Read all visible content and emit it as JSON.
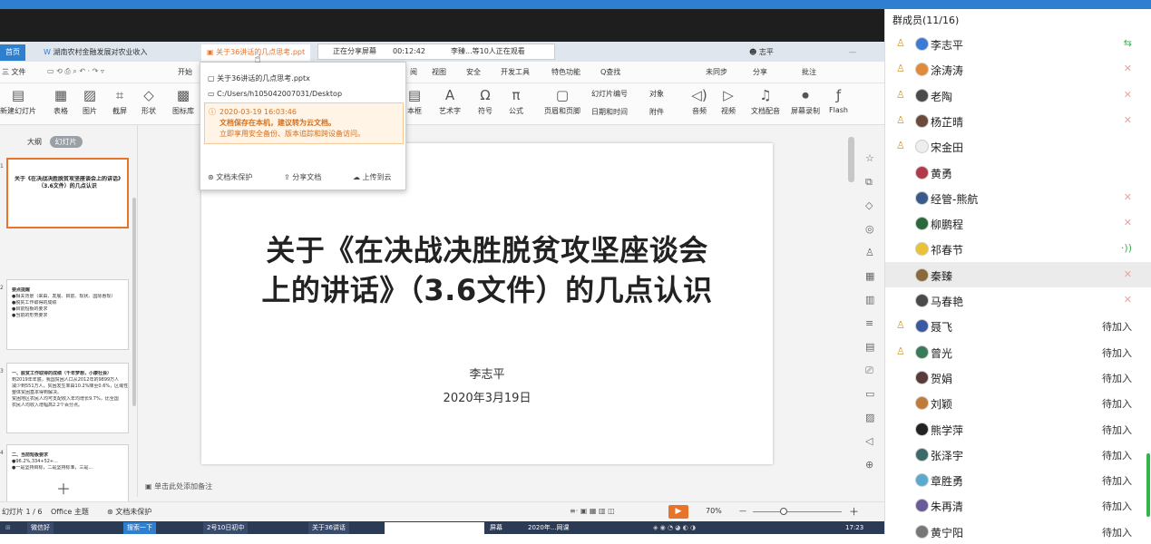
{
  "tabbar": {
    "home_tab": "首页",
    "tab1": "湖南农村金融发展对农业收入",
    "tab2": "关于36讲话的几点思考.ppt",
    "share_status": "正在分享屏幕",
    "share_time": "00:12:42",
    "viewers": "李臻...等10人正在观看",
    "user": "志平"
  },
  "menu": {
    "file": "三 文件",
    "start": "开始",
    "items": [
      "阅",
      "视图",
      "安全",
      "开发工具",
      "特色功能",
      "Q查找"
    ],
    "sync": "未同步",
    "share": "分享",
    "comment": "批注"
  },
  "ribbon": {
    "new_slide": "新建幻灯片",
    "table": "表格",
    "picture": "图片",
    "screenshot": "截屏",
    "shape": "形状",
    "iconlib": "图标库",
    "textbox": "本框",
    "wordart": "艺术字",
    "symbol": "符号",
    "formula": "公式",
    "header_footer": "页眉和页脚",
    "slide_number": "幻灯片编号",
    "date_time": "日期和时间",
    "object": "对象",
    "attachment": "附件",
    "audio": "音频",
    "video": "视频",
    "doc_audio": "文档配音",
    "screen_record": "屏幕录制",
    "flash": "Flash"
  },
  "popup": {
    "filename": "关于36讲话的几点思考.pptx",
    "path": "C:/Users/h105042007031/Desktop",
    "time": "2020-03-19 16:03:46",
    "warn1": "文档保存在本机，建议转为云文档。",
    "warn2": "立即享用安全备份、版本追踪和跨设备访问。",
    "unprotected": "文档未保护",
    "share_doc": "分享文档",
    "upload": "上传到云"
  },
  "thumbs": {
    "outline": "大纲",
    "slides": "幻灯片",
    "t1_title": "关于《在决战决胜脱贫攻坚座谈会上的讲话》（3.6文件）的几点认识",
    "t2_title": "要点提醒",
    "t2_lines": [
      "●相关背景（来由、发展、目前、现状、国际惠现）",
      "●脱贫工作取得的成绩",
      "●目前短板的要求",
      "●当前的形势要求"
    ],
    "t3_title": "一、脱贫工作取得的成绩（千年梦想，小康社会）",
    "t3_lines": [
      "到2019年年底，我国贫困人口从2012年的9899万人",
      "减少到551万人，贫困发生率由10.2%降至0.6%，区域性",
      "整体贫困基本得到解决。",
      "贫困地区农民人均可支配收入年均增长9.7%，比全国",
      "农民人均收入增幅高2.2个百分点。"
    ],
    "t4_title": "二、当前短板要求",
    "t4_lines": [
      "●96.2%,334+52+...",
      "●一是坚持目标，二是坚持标准，三是..."
    ]
  },
  "slide": {
    "title_line1": "关于《在决战决胜脱贫攻坚座谈会",
    "title_line2": "上的讲话》（3.6文件）的几点认识",
    "author": "李志平",
    "date": "2020年3月19日"
  },
  "notes_hint": "单击此处添加备注",
  "status": {
    "slide_index": "幻灯片 1 / 6",
    "theme": "Office 主题",
    "unprotected": "文档未保护",
    "zoom": "70%"
  },
  "taskbar": {
    "time": "17:23",
    "items": [
      "微信好",
      "搜索一下",
      "2号10日初中",
      "关于36讲话",
      "屏幕",
      "2020年...网课"
    ]
  },
  "members": {
    "header": "群成员(11/16)",
    "list": [
      {
        "name": "李志平",
        "host": true,
        "status": "screen",
        "status_text": "⇆",
        "avatar": "#3b7bd6"
      },
      {
        "name": "涂涛涛",
        "host": true,
        "status": "muted",
        "status_text": "✕",
        "avatar": "#e08a3a"
      },
      {
        "name": "老陶",
        "host": true,
        "status": "muted",
        "status_text": "✕",
        "avatar": "#4a4a4a"
      },
      {
        "name": "杨芷晴",
        "host": true,
        "status": "muted",
        "status_text": "✕",
        "avatar": "#6a4a3a"
      },
      {
        "name": "宋金田",
        "host": true,
        "status": "none",
        "status_text": "",
        "avatar": "#eeeeee"
      },
      {
        "name": "黄勇",
        "host": false,
        "status": "none",
        "status_text": "",
        "avatar": "#b03a4a"
      },
      {
        "name": "经管-熊航",
        "host": false,
        "status": "muted",
        "status_text": "✕",
        "avatar": "#3a5a8a"
      },
      {
        "name": "柳鹏程",
        "host": false,
        "status": "muted",
        "status_text": "✕",
        "avatar": "#2a6a3a"
      },
      {
        "name": "祁春节",
        "host": false,
        "status": "speak",
        "status_text": "·))",
        "avatar": "#e8c33a"
      },
      {
        "name": "秦臻",
        "host": false,
        "status": "muted",
        "status_text": "✕",
        "avatar": "#8a6a3a"
      },
      {
        "name": "马春艳",
        "host": false,
        "status": "muted",
        "status_text": "✕",
        "avatar": "#4a4a4a"
      },
      {
        "name": "聂飞",
        "host": true,
        "status": "wait",
        "status_text": "待加入",
        "avatar": "#3a5aa0"
      },
      {
        "name": "曾光",
        "host": true,
        "status": "wait",
        "status_text": "待加入",
        "avatar": "#3a7a5a"
      },
      {
        "name": "贺娟",
        "host": false,
        "status": "wait",
        "status_text": "待加入",
        "avatar": "#5a3a3a"
      },
      {
        "name": "刘颖",
        "host": false,
        "status": "wait",
        "status_text": "待加入",
        "avatar": "#c07a3a"
      },
      {
        "name": "熊学萍",
        "host": false,
        "status": "wait",
        "status_text": "待加入",
        "avatar": "#222222"
      },
      {
        "name": "张泽宇",
        "host": false,
        "status": "wait",
        "status_text": "待加入",
        "avatar": "#3a6a6a"
      },
      {
        "name": "章胜勇",
        "host": false,
        "status": "wait",
        "status_text": "待加入",
        "avatar": "#5aaad0"
      },
      {
        "name": "朱再清",
        "host": false,
        "status": "wait",
        "status_text": "待加入",
        "avatar": "#6a5a9a"
      },
      {
        "name": "黄宁阳",
        "host": false,
        "status": "wait",
        "status_text": "待加入",
        "avatar": "#777777"
      }
    ]
  },
  "colors": {
    "accent_orange": "#e8732a",
    "top_blue": "#2f7fd0",
    "green": "#35b548"
  }
}
